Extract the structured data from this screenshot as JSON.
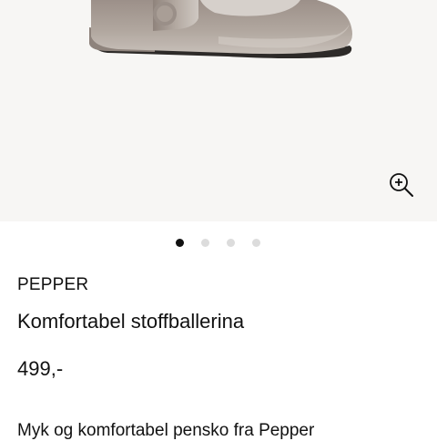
{
  "product": {
    "brand": "PEPPER",
    "title": "Komfortabel stoffballerina",
    "price": "499,-",
    "description": "Myk og komfortabel penskо fra Pepper"
  },
  "gallery": {
    "image_count": 4,
    "active_index": 0,
    "zoom_icon": "zoom-in-icon"
  },
  "colors": {
    "hero_background": "#f7f6f4",
    "shoe_velvet": "#a79c94",
    "dot_active": "#111111",
    "dot_inactive": "#dcdcdc"
  }
}
